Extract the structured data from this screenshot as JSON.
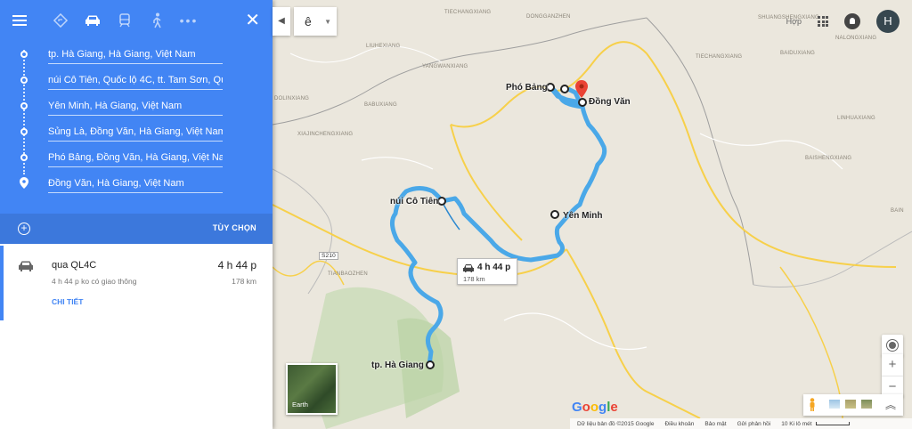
{
  "panel": {
    "modes": [
      "best-route",
      "car",
      "transit",
      "walking",
      "more"
    ],
    "active_mode": "car",
    "waypoints": [
      "tp. Hà Giang, Hà Giang, Việt Nam",
      "núi Cô Tiên, Quốc lộ 4C, tt. Tam Sơn, Qu",
      "Yên Minh, Hà Giang, Việt Nam",
      "Sủng Là, Đồng Văn, Hà Giang, Việt Nam",
      "Phó Bảng, Đồng Văn, Hà Giang, Việt Nam",
      "Đồng Văn, Hà Giang, Việt Nam"
    ],
    "options_label": "TÙY CHỌN",
    "route": {
      "via": "qua QL4C",
      "time": "4 h 44 p",
      "subtitle": "4 h 44 p ko có giao thông",
      "distance": "178 km",
      "details_link": "CHI TIẾT"
    }
  },
  "search": {
    "text": "ê"
  },
  "top_right": {
    "partial_text": "Hợp",
    "avatar_letter": "H"
  },
  "map": {
    "route_box": {
      "time": "4 h 44 p",
      "distance": "178 km"
    },
    "towns": {
      "pho_bang": "Phó Bảng",
      "dong_van": "Đồng Văn",
      "nui_co_tien": "núi Cô Tiên",
      "yen_minh": "Yên Minh",
      "ha_giang": "tp. Hà Giang"
    },
    "places": {
      "tiechangxiang": "TIECHANGXIANG",
      "dongganzhen": "DONGGANZHEN",
      "liuhexiang": "LIUHEXIANG",
      "yangwanxiang": "YANGWANXIANG",
      "babuxiang": "BABUXIANG",
      "dolinxiang": "DOLINXIANG",
      "xiajinchengxiang": "XIAJINCHENGXIANG",
      "tianbaozhen": "TIANBAOZHEN",
      "shuangshengxiang": "SHUANGSHENGXIANG",
      "nalongxiang": "NALONGXIANG",
      "baiduxiang": "BAIDUXIANG",
      "tiechangxiang2": "TIECHANGXIANG",
      "linhuaxiang": "LINHUAXIANG",
      "baishengxiang": "BAISHENGXIANG",
      "s210": "S210",
      "bain": "BAIN"
    },
    "earth_label": "Earth",
    "footer": {
      "data": "Dữ liệu bản đồ ©2015 Google",
      "terms": "Điều khoản",
      "privacy": "Bảo mật",
      "feedback": "Gửi phản hồi",
      "scale": "10 Ki lô mét"
    }
  },
  "colors": {
    "panel_blue": "#4285f4",
    "route_blue": "#4aa8e8",
    "border_yellow": "#f7d04a",
    "border_gray": "#9e9e9e",
    "pin_red": "#ea4335"
  }
}
